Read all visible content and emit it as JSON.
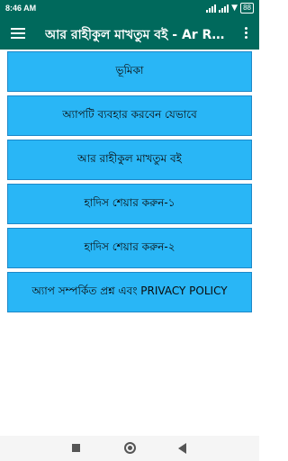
{
  "status_bar": {
    "time": "8:46 AM",
    "battery": "88"
  },
  "app_bar": {
    "title": "আর রাহীকুল মাখতুম বই - Ar Ra...",
    "menu_icon": "hamburger-menu-icon",
    "overflow_icon": "more-vert-icon"
  },
  "menu": {
    "items": [
      {
        "label": "ভূমিকা"
      },
      {
        "label": "অ্যাপটি ব্যবহার করবেন যেভাবে"
      },
      {
        "label": "আর রাহীকুল মাখতুম বই"
      },
      {
        "label": "হাদিস শেয়ার করুন-১"
      },
      {
        "label": "হাদিস শেয়ার করুন-২"
      },
      {
        "label": "অ্যাপ সম্পর্কিত প্রশ্ন এবং PRIVACY POLICY"
      }
    ]
  },
  "colors": {
    "primary": "#00695c",
    "button": "#29b6f6"
  }
}
